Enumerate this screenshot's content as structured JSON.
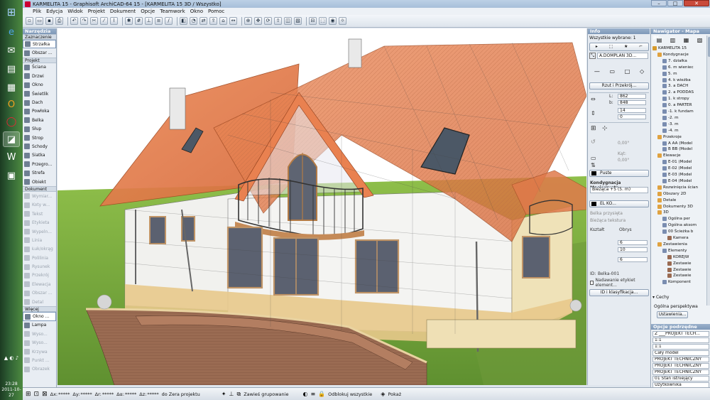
{
  "window": {
    "title": "KARMELITA 15 - Graphisoft ArchiCAD-64 15 - [KARMELITA 15 3D / Wszystko]"
  },
  "menu": [
    "Plik",
    "Edycja",
    "Widok",
    "Projekt",
    "Dokument",
    "Opcje",
    "Teamwork",
    "Okno",
    "Pomoc"
  ],
  "taskbar": {
    "time": "23:28",
    "date": "2011-10-27"
  },
  "toolbox": {
    "title": "Narzędzia",
    "groups": [
      {
        "label": "Zaznaczenie",
        "items": [
          {
            "label": "Strzałka",
            "selected": true
          },
          {
            "label": "Obszar ..."
          }
        ]
      },
      {
        "label": "Projekt",
        "items": [
          {
            "label": "Ściana"
          },
          {
            "label": "Drzwi"
          },
          {
            "label": "Okno"
          },
          {
            "label": "Świetlik"
          },
          {
            "label": "Dach"
          },
          {
            "label": "Powłoka"
          },
          {
            "label": "Belka"
          },
          {
            "label": "Słup"
          },
          {
            "label": "Strop"
          },
          {
            "label": "Schody"
          },
          {
            "label": "Siatka"
          },
          {
            "label": "Przegro..."
          },
          {
            "label": "Strefa"
          },
          {
            "label": "Obiekt"
          }
        ]
      },
      {
        "label": "Dokument",
        "items": [
          {
            "label": "Wymiar...",
            "dim": true
          },
          {
            "label": "Koty w...",
            "dim": true
          },
          {
            "label": "Tekst",
            "dim": true
          },
          {
            "label": "Etykieta",
            "dim": true
          },
          {
            "label": "Wypeln...",
            "dim": true
          },
          {
            "label": "Linia",
            "dim": true
          },
          {
            "label": "Łuk/okrąg",
            "dim": true
          },
          {
            "label": "Polilinia",
            "dim": true
          },
          {
            "label": "Rysunek",
            "dim": true
          },
          {
            "label": "Przekrój",
            "dim": true
          },
          {
            "label": "Elewacja",
            "dim": true
          },
          {
            "label": "Obszar ...",
            "dim": true
          },
          {
            "label": "Detal",
            "dim": true
          }
        ]
      },
      {
        "label": "Więcej",
        "items": [
          {
            "label": "Okno ...",
            "selected": true
          },
          {
            "label": "Lampa"
          },
          {
            "label": "Wyso...",
            "dim": true
          },
          {
            "label": "Wyso...",
            "dim": true
          },
          {
            "label": "Krzywa",
            "dim": true
          },
          {
            "label": "Punkt ...",
            "dim": true
          },
          {
            "label": "Obrazek",
            "dim": true
          }
        ]
      }
    ]
  },
  "infobox": {
    "title": "Info",
    "selection": "Wszystkie wybrane: 1",
    "element_name": "A.DOMPLAN 3D...",
    "projection_button": "Rzut i Przekrój...",
    "dims": {
      "a": "862",
      "b": "848",
      "h": "14",
      "z": "0"
    },
    "angle1": "0,00°",
    "angle2_label": "Kąt:",
    "angle2": "0,00°",
    "surface": "Puste",
    "story_label": "Kondygnacja Macierzysta",
    "story_value": "Bieżąca +5 (5. m)",
    "layer": "EL KO...",
    "cut_label": "Belka przysięta",
    "section_label": "Bieżąca tekstura",
    "row_labels": {
      "kształt": "Kształt",
      "obrys": "Obrys"
    },
    "values": [
      "6",
      "10",
      "6"
    ],
    "id_label": "ID:",
    "id_value": "Belka-001",
    "auto_label": "Nadawanie etykiet element...",
    "classify_button": "ID i klasyfikacja..."
  },
  "navigator": {
    "title": "Nawigator - Mapa pr...",
    "tree": [
      {
        "label": "KARMELITA 15",
        "indent": 0
      },
      {
        "label": "Kondygnacje",
        "indent": 1
      },
      {
        "label": "7. działka",
        "indent": 2
      },
      {
        "label": "6. m wieniec",
        "indent": 2
      },
      {
        "label": "5. m",
        "indent": 2
      },
      {
        "label": "4. k wieżba",
        "indent": 2
      },
      {
        "label": "3. a DACH",
        "indent": 2
      },
      {
        "label": "2. a PODDAS",
        "indent": 2
      },
      {
        "label": "1. k stropy",
        "indent": 2
      },
      {
        "label": "0. a PARTER",
        "indent": 2
      },
      {
        "label": "-1. k fundam",
        "indent": 2
      },
      {
        "label": "-2. m",
        "indent": 2
      },
      {
        "label": "-3. m",
        "indent": 2
      },
      {
        "label": "-4. m",
        "indent": 2
      },
      {
        "label": "Przekroje",
        "indent": 1
      },
      {
        "label": "A AA (Model",
        "indent": 2
      },
      {
        "label": "B BB (Model",
        "indent": 2
      },
      {
        "label": "Elewacje",
        "indent": 1
      },
      {
        "label": "E-01 (Model",
        "indent": 2
      },
      {
        "label": "E-02 (Model",
        "indent": 2
      },
      {
        "label": "E-03 (Model",
        "indent": 2
      },
      {
        "label": "E-04 (Model",
        "indent": 2
      },
      {
        "label": "Rozwinięcia ścian",
        "indent": 1
      },
      {
        "label": "Obszary 2D",
        "indent": 1
      },
      {
        "label": "Detale",
        "indent": 1
      },
      {
        "label": "Dokumenty 3D",
        "indent": 1
      },
      {
        "label": "3D",
        "indent": 1
      },
      {
        "label": "Ogólna per",
        "indent": 2
      },
      {
        "label": "Ogólna aksom",
        "indent": 2
      },
      {
        "label": "00 Ścieżka b",
        "indent": 2
      },
      {
        "label": "Kamera",
        "indent": 3
      },
      {
        "label": "Zestawienia",
        "indent": 1
      },
      {
        "label": "Elementy",
        "indent": 2
      },
      {
        "label": "KOREJW",
        "indent": 3
      },
      {
        "label": "Zestawie",
        "indent": 3
      },
      {
        "label": "Zestawie",
        "indent": 3
      },
      {
        "label": "Zestawie",
        "indent": 3
      },
      {
        "label": "Komponent",
        "indent": 2
      }
    ],
    "props_label": "Cechy",
    "perspective_label": "Ogólna perspektywa",
    "settings_button": "Ustawienia...",
    "sub_title": "Opcje podrzędne",
    "options": [
      "Z ___PROJEKT TECH...",
      "1:1",
      "1:1",
      "Cały model",
      "PROJEKT TECHNICZNY",
      "PROJEKT TECHNICZNY",
      "PROJEKT TECHNICZNY",
      "01 Stan istniejący",
      "Użytkownika"
    ]
  },
  "statusbar": {
    "ax_label": "Δx:",
    "ax": "*****",
    "ay_label": "Δy:",
    "ay": "*****",
    "ar_label": "Δr:",
    "ar": "*****",
    "aa_label": "Δα:",
    "aa": "*****",
    "z_label": "Δz:",
    "z": "*****",
    "ref": "do Zera projektu",
    "suspend": "Zawieś grupowanie",
    "unlock": "Odblokuj wszystkie",
    "show": "Pokaż"
  },
  "colors": {
    "roof": "#e07a4b",
    "wall": "#eef0f0",
    "trim": "#c9a06a",
    "grass": "#7aaa3f",
    "terrace": "#9a6b52",
    "sky": "#ffffff"
  }
}
